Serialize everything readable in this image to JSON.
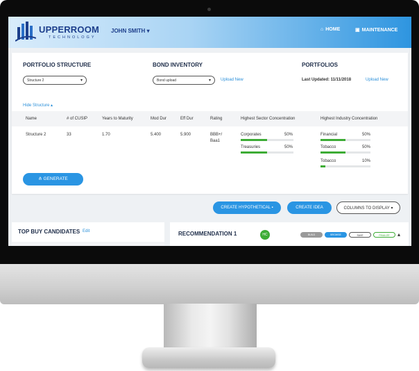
{
  "header": {
    "brand": "UPPERROOM",
    "brand_sub": "TECHNOLOGY",
    "user": "JOHN SMITH",
    "nav_home": "HOME",
    "nav_maintenance": "MAINTENANCE"
  },
  "portfolio_structure": {
    "title": "PORTFOLIO STRUCTURE",
    "selected": "Structure 2"
  },
  "bond_inventory": {
    "title": "BOND INVENTORY",
    "selected": "Bond upload",
    "upload_link": "Upload New"
  },
  "portfolios": {
    "title": "PORTFOLIOS",
    "last_updated": "Last Updated: 11/11/2018",
    "upload_link": "Upload New"
  },
  "hide_structure": "Hide Structure",
  "table": {
    "headers": [
      "Name",
      "# of CUSIP",
      "Years to Maturity",
      "Mod Dur",
      "Eff Dur",
      "Rating",
      "Highest Sector Concentration",
      "Highest Industry Concentration"
    ],
    "row": {
      "name": "Structure 2",
      "cusip": "33",
      "ytm": "1.70",
      "mod_dur": "5.400",
      "eff_dur": "5.900",
      "rating_line1": "BBB+/",
      "rating_line2": "Baa1"
    },
    "sectors": [
      {
        "label": "Corporates",
        "pct": "50%",
        "fill": 0.5
      },
      {
        "label": "Treasuries",
        "pct": "50%",
        "fill": 0.5
      }
    ],
    "industries": [
      {
        "label": "Financial",
        "pct": "50%",
        "fill": 0.5
      },
      {
        "label": "Tobacco",
        "pct": "50%",
        "fill": 0.5
      },
      {
        "label": "Tobacco",
        "pct": "10%",
        "fill": 0.1
      }
    ]
  },
  "generate_label": "GENERATE",
  "actions": {
    "create_hypothetical": "CREATE HYPOTHETICAL",
    "create_idea": "CREATE IDEA",
    "columns_to_display": "COLUMNS TO DISPLAY"
  },
  "top_buy": {
    "title": "TOP BUY CANDIDATES",
    "edit": "Edit"
  },
  "recommendation": {
    "title": "RECOMMENDATION 1",
    "badge": "HC",
    "buttons": [
      "BUILD",
      "BROWSE",
      "SAVE",
      "FINALIZE"
    ]
  },
  "colors": {
    "accent_blue": "#2a95e3",
    "green": "#3dac35",
    "navy": "#1d3f8c"
  }
}
